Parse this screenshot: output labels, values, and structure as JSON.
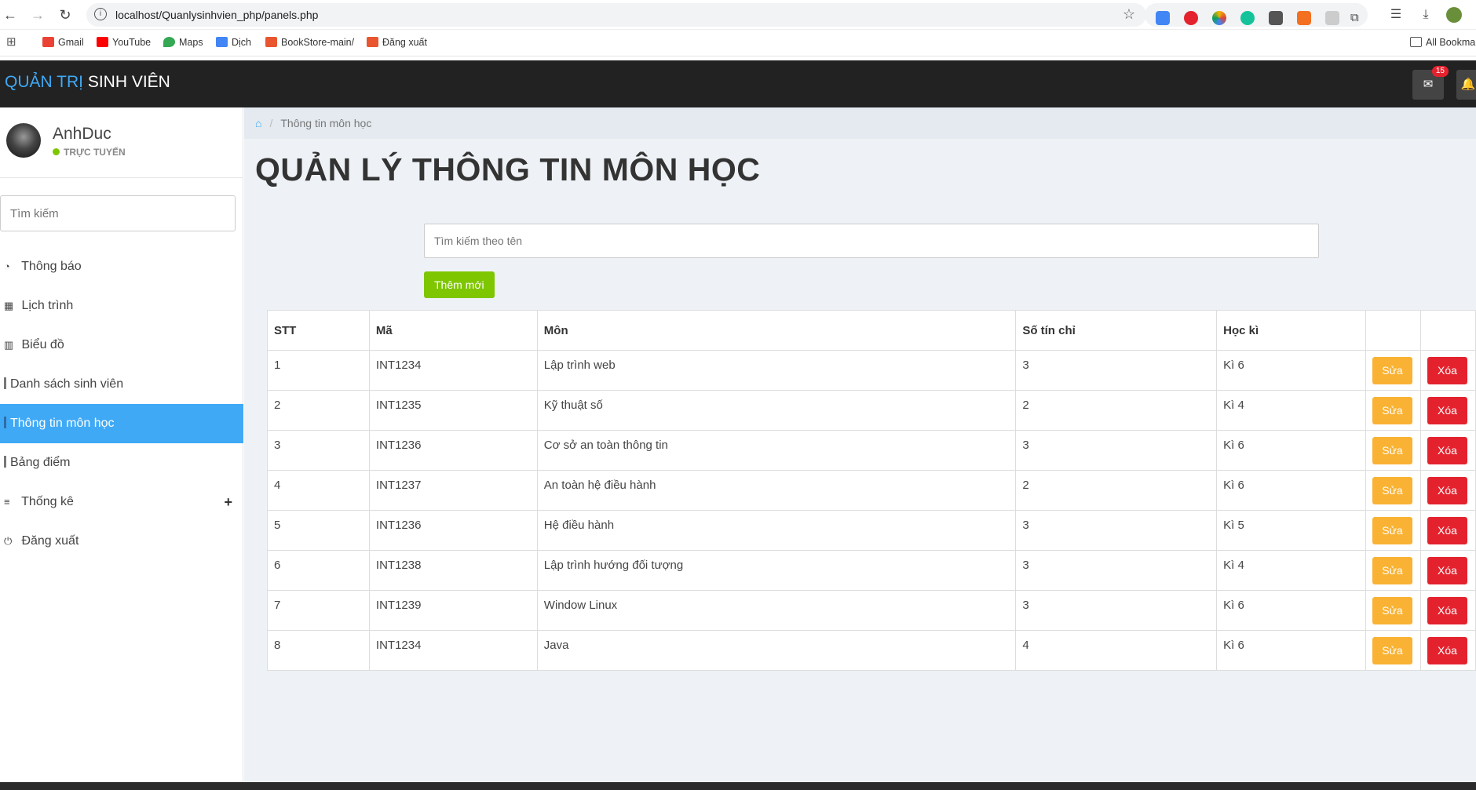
{
  "browser": {
    "url": "localhost/Quanlysinhvien_php/panels.php",
    "bookmarks": [
      {
        "label": "Gmail",
        "color": "#ea4335"
      },
      {
        "label": "YouTube",
        "color": "#ff0000"
      },
      {
        "label": "Maps",
        "color": "#34a853"
      },
      {
        "label": "Dịch",
        "color": "#4285f4"
      },
      {
        "label": "BookStore-main/",
        "color": "#e8552e"
      },
      {
        "label": "Đăng xuất",
        "color": "#e8552e"
      }
    ],
    "all_bookmarks": "All Bookma"
  },
  "header": {
    "brand_part1": "QUẢN TRỊ",
    "brand_part2": "SINH VIÊN",
    "mail_badge": "15"
  },
  "sidebar": {
    "user_name": "AnhDuc",
    "user_status": "TRỰC TUYẾN",
    "search_placeholder": "Tìm kiếm",
    "items": [
      {
        "label": "Thông báo",
        "icon": "dashboard-icon"
      },
      {
        "label": "Lịch trình",
        "icon": "calendar-icon"
      },
      {
        "label": "Biểu đồ",
        "icon": "bar-chart-icon"
      },
      {
        "label": "Danh sách sinh viên",
        "icon": "bar-icon"
      },
      {
        "label": "Thông tin môn học",
        "icon": "bar-icon"
      },
      {
        "label": "Bảng điểm",
        "icon": "bar-icon"
      },
      {
        "label": "Thống kê",
        "icon": "list-icon"
      },
      {
        "label": "Đăng xuất",
        "icon": "power-icon"
      }
    ]
  },
  "main": {
    "breadcrumb": "Thông tin môn học",
    "title": "QUẢN LÝ THÔNG TIN MÔN HỌC",
    "search_placeholder": "Tìm kiếm theo tên",
    "add_button": "Thêm mới",
    "table": {
      "headers": [
        "STT",
        "Mã",
        "Môn",
        "Số tín chỉ",
        "Học kì"
      ],
      "edit_label": "Sửa",
      "delete_label": "Xóa",
      "rows": [
        [
          "1",
          "INT1234",
          "Lập trình web",
          "3",
          "Kì 6"
        ],
        [
          "2",
          "INT1235",
          "Kỹ thuật số",
          "2",
          "Kì 4"
        ],
        [
          "3",
          "INT1236",
          "Cơ sở an toàn thông tin",
          "3",
          "Kì 6"
        ],
        [
          "4",
          "INT1237",
          "An toàn hệ điều hành",
          "2",
          "Kì 6"
        ],
        [
          "5",
          "INT1236",
          "Hệ điều hành",
          "3",
          "Kì 5"
        ],
        [
          "6",
          "INT1238",
          "Lập trình hướng đối tượng",
          "3",
          "Kì 4"
        ],
        [
          "7",
          "INT1239",
          "Window Linux",
          "3",
          "Kì 6"
        ],
        [
          "8",
          "INT1234",
          "Java",
          "4",
          "Kì 6"
        ]
      ]
    }
  },
  "colors": {
    "accent": "#3fa9f5",
    "add": "#7ec600",
    "edit": "#f9b233",
    "delete": "#e4222e"
  }
}
